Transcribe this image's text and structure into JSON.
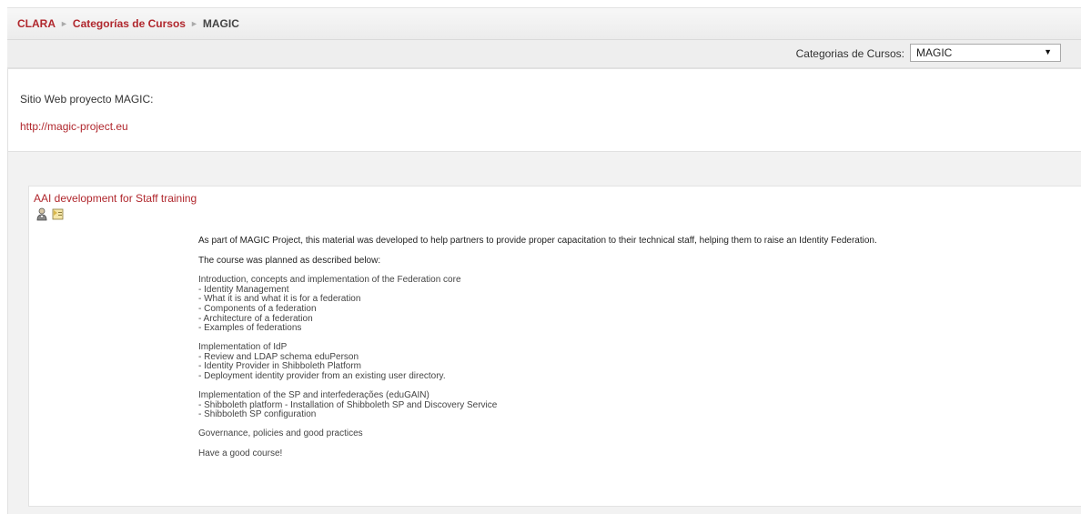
{
  "breadcrumb": {
    "items": [
      "CLARA",
      "Categorías de Cursos"
    ],
    "current": "MAGIC",
    "separator": "►"
  },
  "jumpbar": {
    "label": "Categorias de Cursos:",
    "selected": "MAGIC"
  },
  "category_description": {
    "text": "Sitio Web proyecto MAGIC:",
    "link": "http://magic-project.eu"
  },
  "course": {
    "name": "AAI development for Staff training",
    "icons": [
      "teacher-icon",
      "guest-access-icon"
    ],
    "summary": {
      "intro": "As part of MAGIC Project, this material was developed to help partners to provide proper capacitation to their technical staff, helping them to raise an Identity Federation.",
      "planned": "The course was planned as described below:",
      "blocks": [
        [
          "Introduction, concepts and implementation of the Federation core",
          "- Identity Management",
          "- What it is and what it is for a federation",
          "- Components of a federation",
          "- Architecture of a federation",
          "- Examples of federations"
        ],
        [
          "Implementation of IdP",
          "- Review and LDAP schema eduPerson",
          "- Identity Provider in Shibboleth Platform",
          "- Deployment identity provider from an existing user directory."
        ],
        [
          "Implementation of the SP and interfederações (eduGAIN)",
          "- Shibboleth platform - Installation of Shibboleth SP and Discovery Service",
          "- Shibboleth SP configuration"
        ],
        [
          "Governance, policies and good practices"
        ],
        [
          "Have a good course!"
        ]
      ]
    }
  },
  "colors": {
    "link": "#b0272d",
    "navbar_bg": "#f2f2f2",
    "jumpbar_bg": "#eeeeee"
  }
}
